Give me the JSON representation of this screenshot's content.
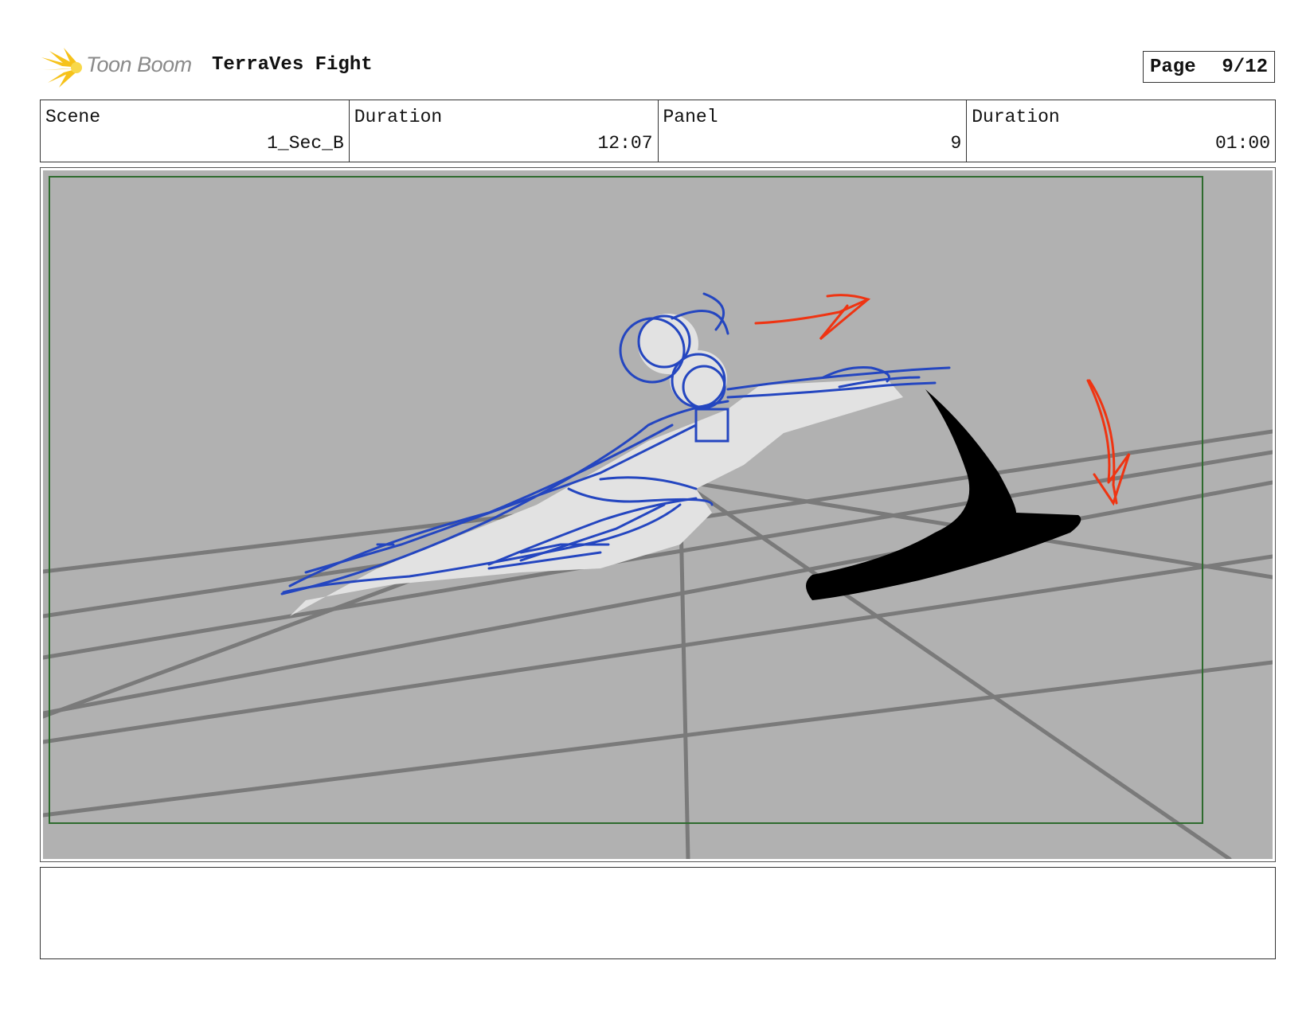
{
  "header": {
    "logo_text": "Toon Boom",
    "project_title": "TerraVes Fight",
    "page_label": "Page",
    "page_number": "9/12"
  },
  "info": {
    "scene_label": "Scene",
    "scene_value": "1_Sec_B",
    "scene_duration_label": "Duration",
    "scene_duration_value": "12:07",
    "panel_label": "Panel",
    "panel_value": "9",
    "panel_duration_label": "Duration",
    "panel_duration_value": "01:00"
  },
  "notes": {
    "text": ""
  },
  "colors": {
    "frame_border": "#2e6b2e",
    "background": "#b1b1b1",
    "perspective_lines": "#7a7a7a",
    "character_lines": "#2446c0",
    "motion_arrows": "#ef3412",
    "shadow": "#000000"
  }
}
